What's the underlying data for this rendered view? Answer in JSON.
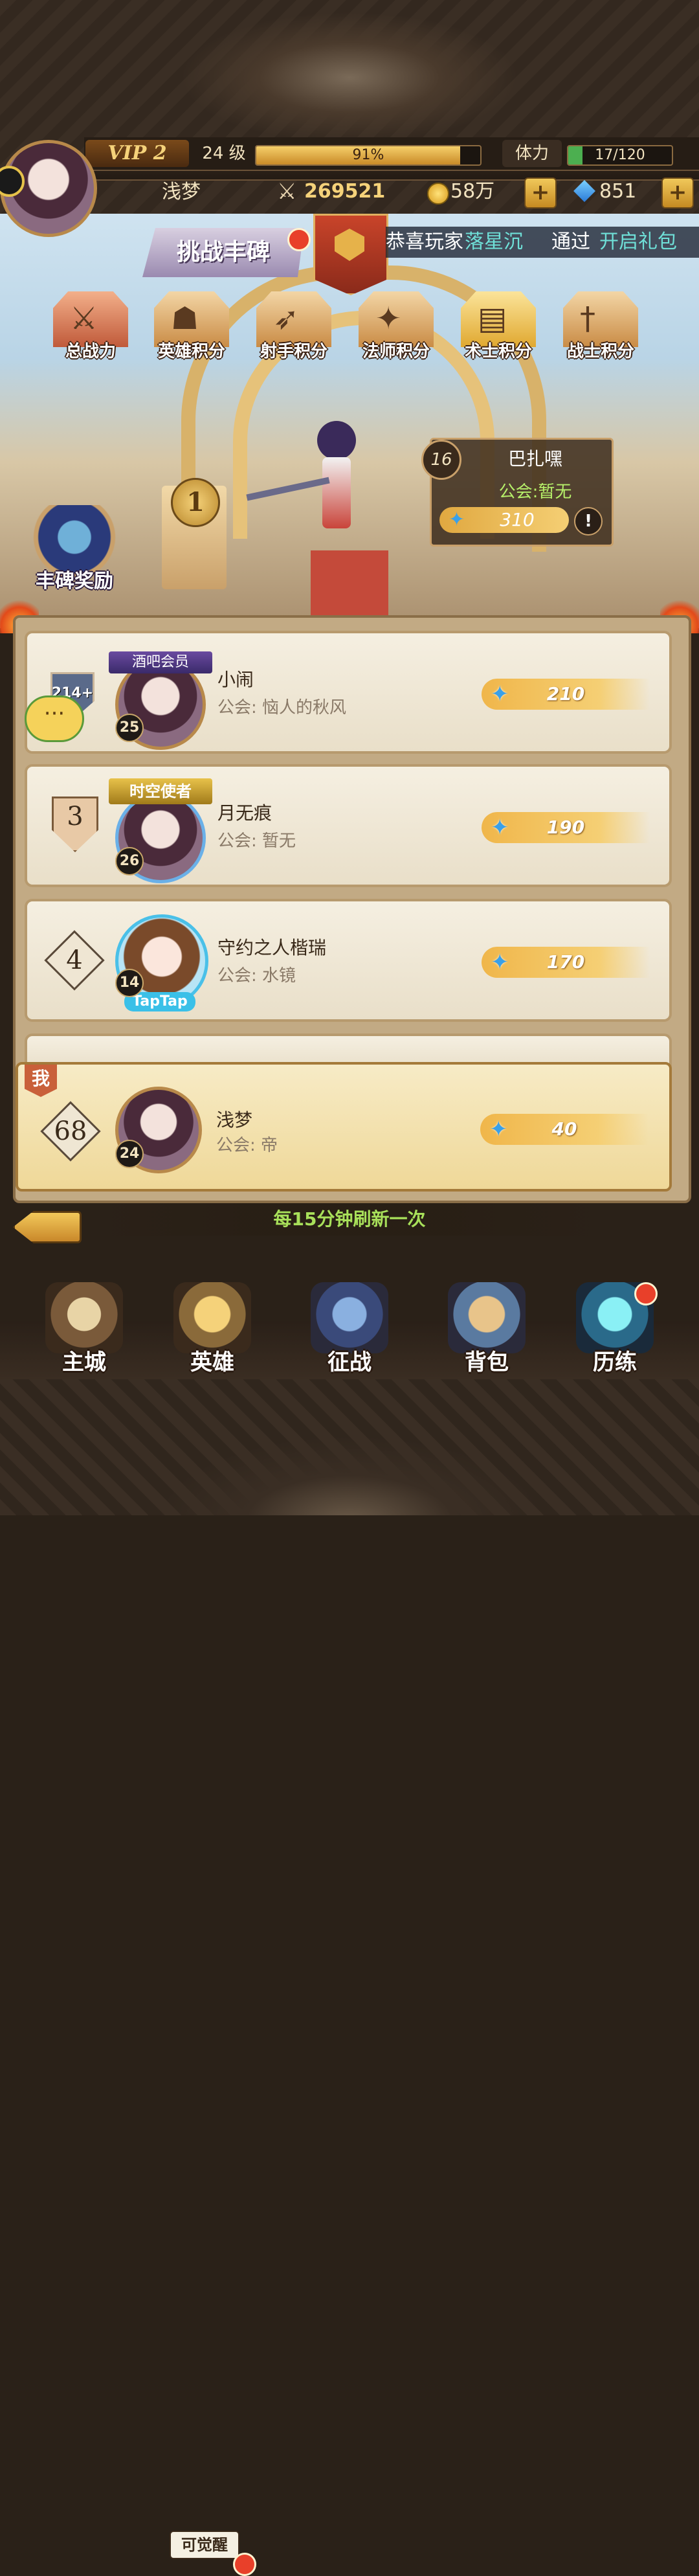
{
  "player": {
    "vip": "VIP 2",
    "level": "24 级",
    "exp_percent": "91%",
    "exp_fraction": 0.91,
    "name": "浅梦",
    "power": "269521",
    "gold": "58万",
    "gems": "851",
    "stamina_label": "体力",
    "stamina": "17/120",
    "stamina_fraction": 0.14
  },
  "challenge_button": "挑战丰碑",
  "marquee": {
    "prefix": "恭喜玩家",
    "player": "落星沉",
    "mid": "通过",
    "action": "开启礼包"
  },
  "categories": [
    {
      "label": "总战力",
      "icon": "crossed-swords-icon",
      "sym": "⚔"
    },
    {
      "label": "英雄积分",
      "icon": "hero-helmet-icon",
      "sym": "☗"
    },
    {
      "label": "射手积分",
      "icon": "bow-icon",
      "sym": "➶"
    },
    {
      "label": "法师积分",
      "icon": "staff-icon",
      "sym": "✦"
    },
    {
      "label": "术士积分",
      "icon": "tome-icon",
      "sym": "▤"
    },
    {
      "label": "战士积分",
      "icon": "sword-icon",
      "sym": "†"
    }
  ],
  "first_place": {
    "rank": "1",
    "level": "16",
    "name": "巴扎嘿",
    "guild": "公会:暂无",
    "score": "310",
    "info": "!"
  },
  "reward_label": "丰碑奖励",
  "rows": [
    {
      "rank": "214+",
      "badge": "酒吧会员",
      "level": "25",
      "name": "小闹",
      "guild": "公会: 恼人的秋风",
      "score": "210"
    },
    {
      "rank": "3",
      "badge": "时空使者",
      "level": "26",
      "name": "月无痕",
      "guild": "公会: 暂无",
      "score": "190"
    },
    {
      "rank": "4",
      "badge": "TapTap",
      "level": "14",
      "name": "守约之人楷瑞",
      "guild": "公会: 水镜",
      "score": "170"
    }
  ],
  "me": {
    "tag": "我",
    "rank": "68",
    "level": "24",
    "name": "浅梦",
    "guild": "公会: 帝",
    "score": "40"
  },
  "refresh_note": "每15分钟刷新一次",
  "awaken_tag": "可觉醒",
  "nav": [
    {
      "label": "主城",
      "icon": "castle-icon"
    },
    {
      "label": "英雄",
      "icon": "helmet-icon"
    },
    {
      "label": "征战",
      "icon": "battle-shield-icon"
    },
    {
      "label": "背包",
      "icon": "backpack-icon"
    },
    {
      "label": "历练",
      "icon": "portal-icon"
    }
  ]
}
